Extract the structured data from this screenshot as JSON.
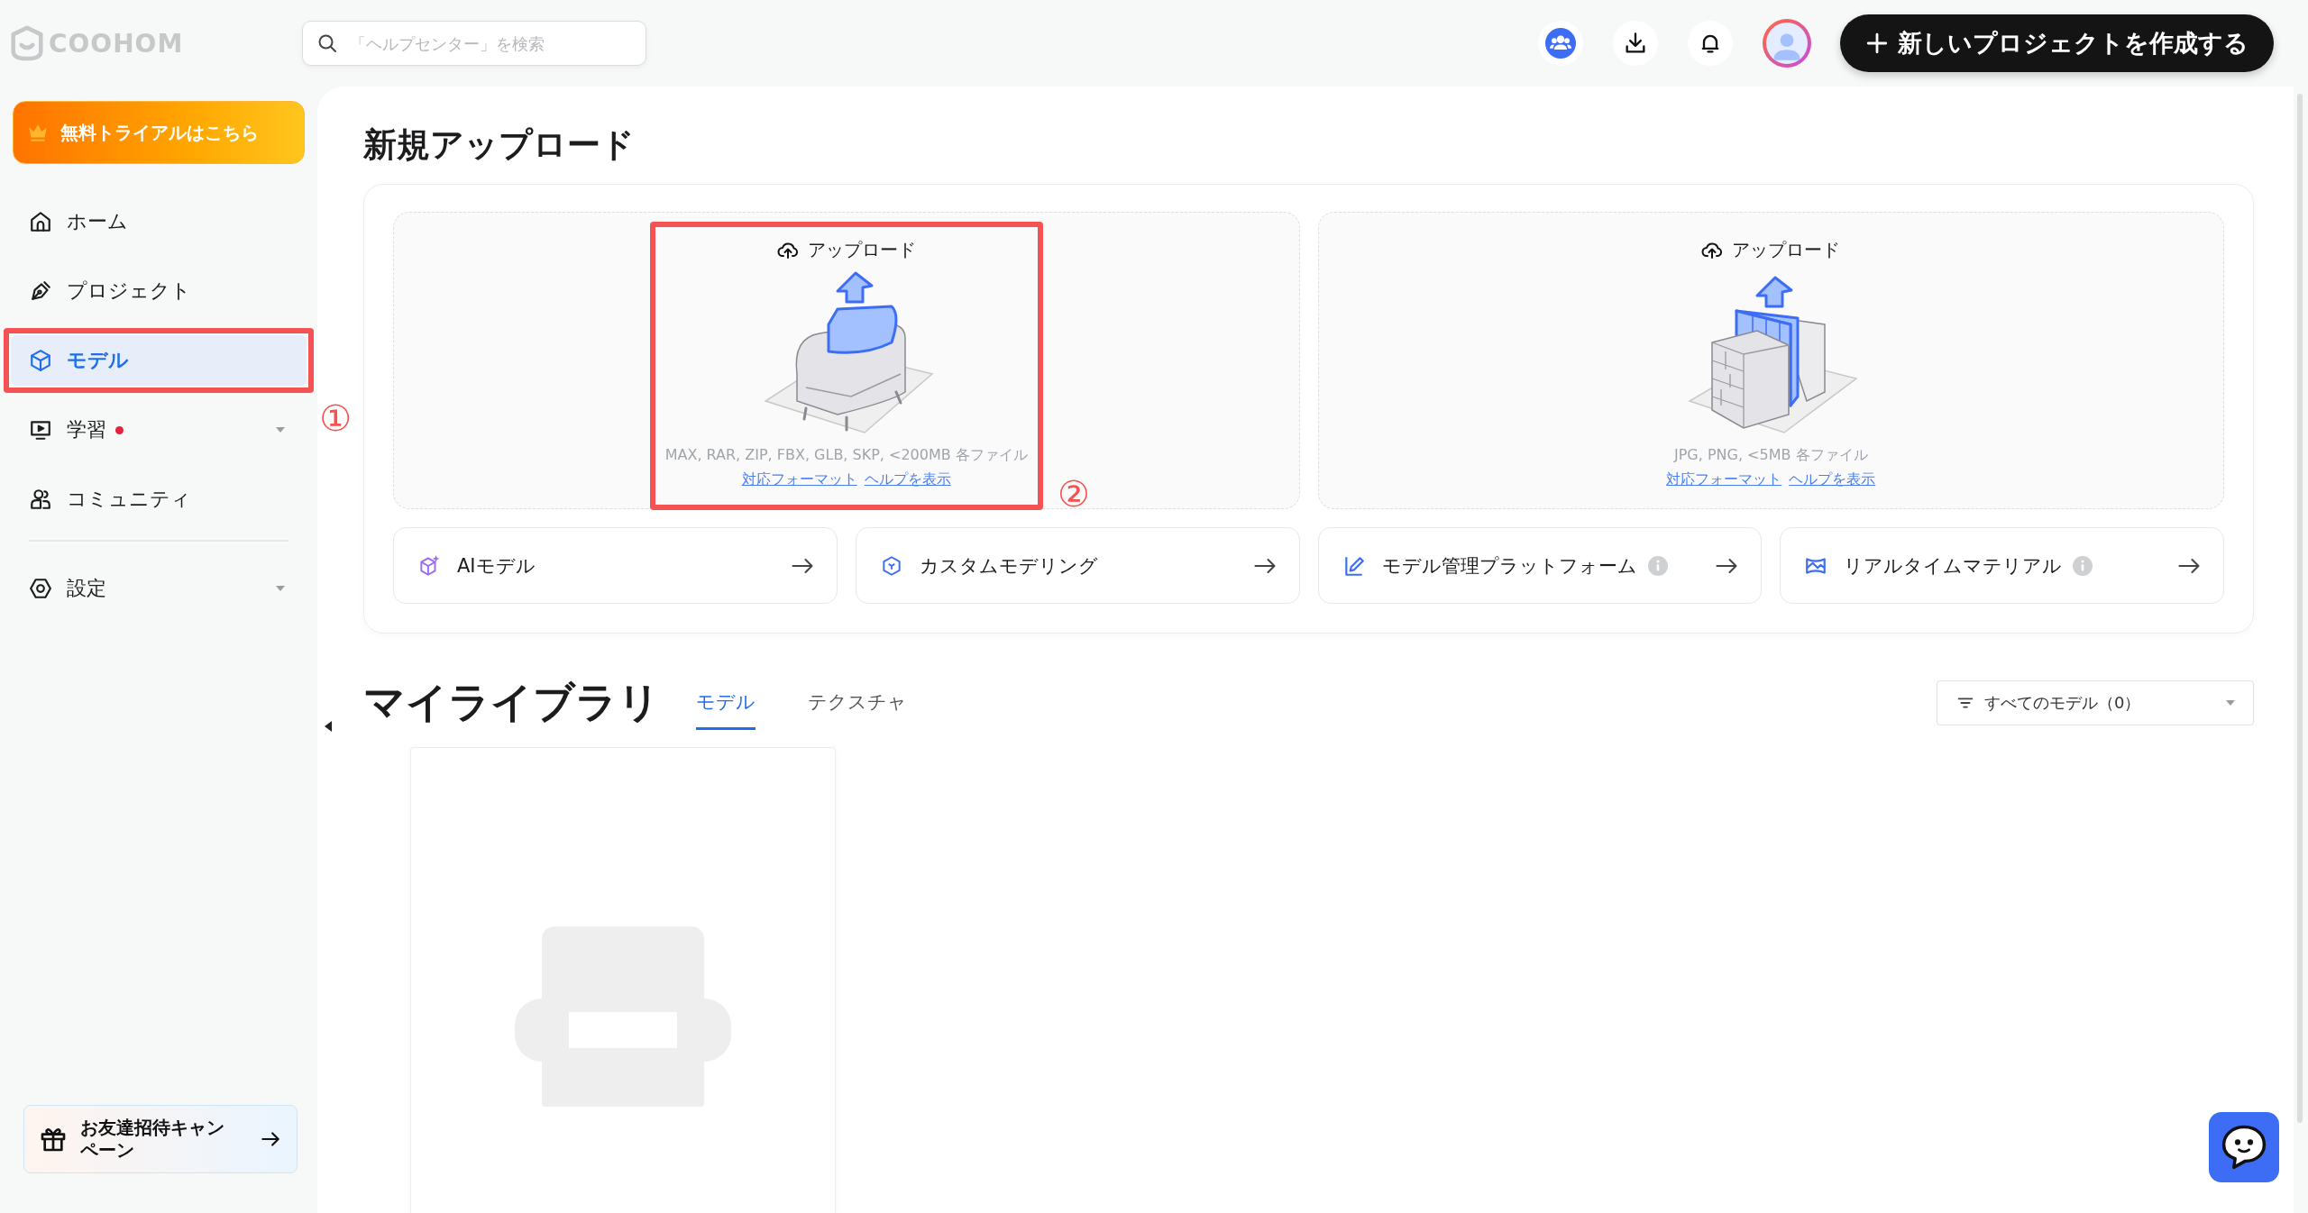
{
  "logo": {
    "text": "COOHOM"
  },
  "search": {
    "placeholder": "「ヘルプセンター」を検索"
  },
  "create_button": {
    "label": "新しいプロジェクトを作成する"
  },
  "trial_button": {
    "label": "無料トライアルはこちら"
  },
  "sidebar": {
    "items": [
      {
        "label": "ホーム",
        "selected": false,
        "expandable": false,
        "dot": false
      },
      {
        "label": "プロジェクト",
        "selected": false,
        "expandable": false,
        "dot": false
      },
      {
        "label": "モデル",
        "selected": true,
        "expandable": false,
        "dot": false,
        "annotation": "①"
      },
      {
        "label": "学習",
        "selected": false,
        "expandable": true,
        "dot": true
      },
      {
        "label": "コミュニティ",
        "selected": false,
        "expandable": false,
        "dot": false
      },
      {
        "label": "設定",
        "selected": false,
        "expandable": true,
        "dot": false
      }
    ]
  },
  "invite_card": {
    "text": "お友達招待キャンペーン"
  },
  "new_upload": {
    "title": "新規アップロード",
    "uploads": [
      {
        "kind": "model",
        "label": "アップロード",
        "formats": "MAX, RAR, ZIP, FBX, GLB, SKP, <200MB 各ファイル",
        "links": [
          "対応フォーマット",
          "ヘルプを表示"
        ],
        "annotation": "②"
      },
      {
        "kind": "texture",
        "label": "アップロード",
        "formats": "JPG, PNG, <5MB 各ファイル",
        "links": [
          "対応フォーマット",
          "ヘルプを表示"
        ]
      }
    ],
    "shortcuts": [
      {
        "label": "AIモデル",
        "info": false
      },
      {
        "label": "カスタムモデリング",
        "info": false
      },
      {
        "label": "モデル管理プラットフォーム",
        "info": true
      },
      {
        "label": "リアルタイムマテリアル",
        "info": true
      }
    ]
  },
  "library": {
    "title": "マイライブラリ",
    "tabs": [
      {
        "label": "モデル",
        "selected": true
      },
      {
        "label": "テクスチャ",
        "selected": false
      }
    ],
    "filter": {
      "label": "すべてのモデル（0）"
    }
  }
}
